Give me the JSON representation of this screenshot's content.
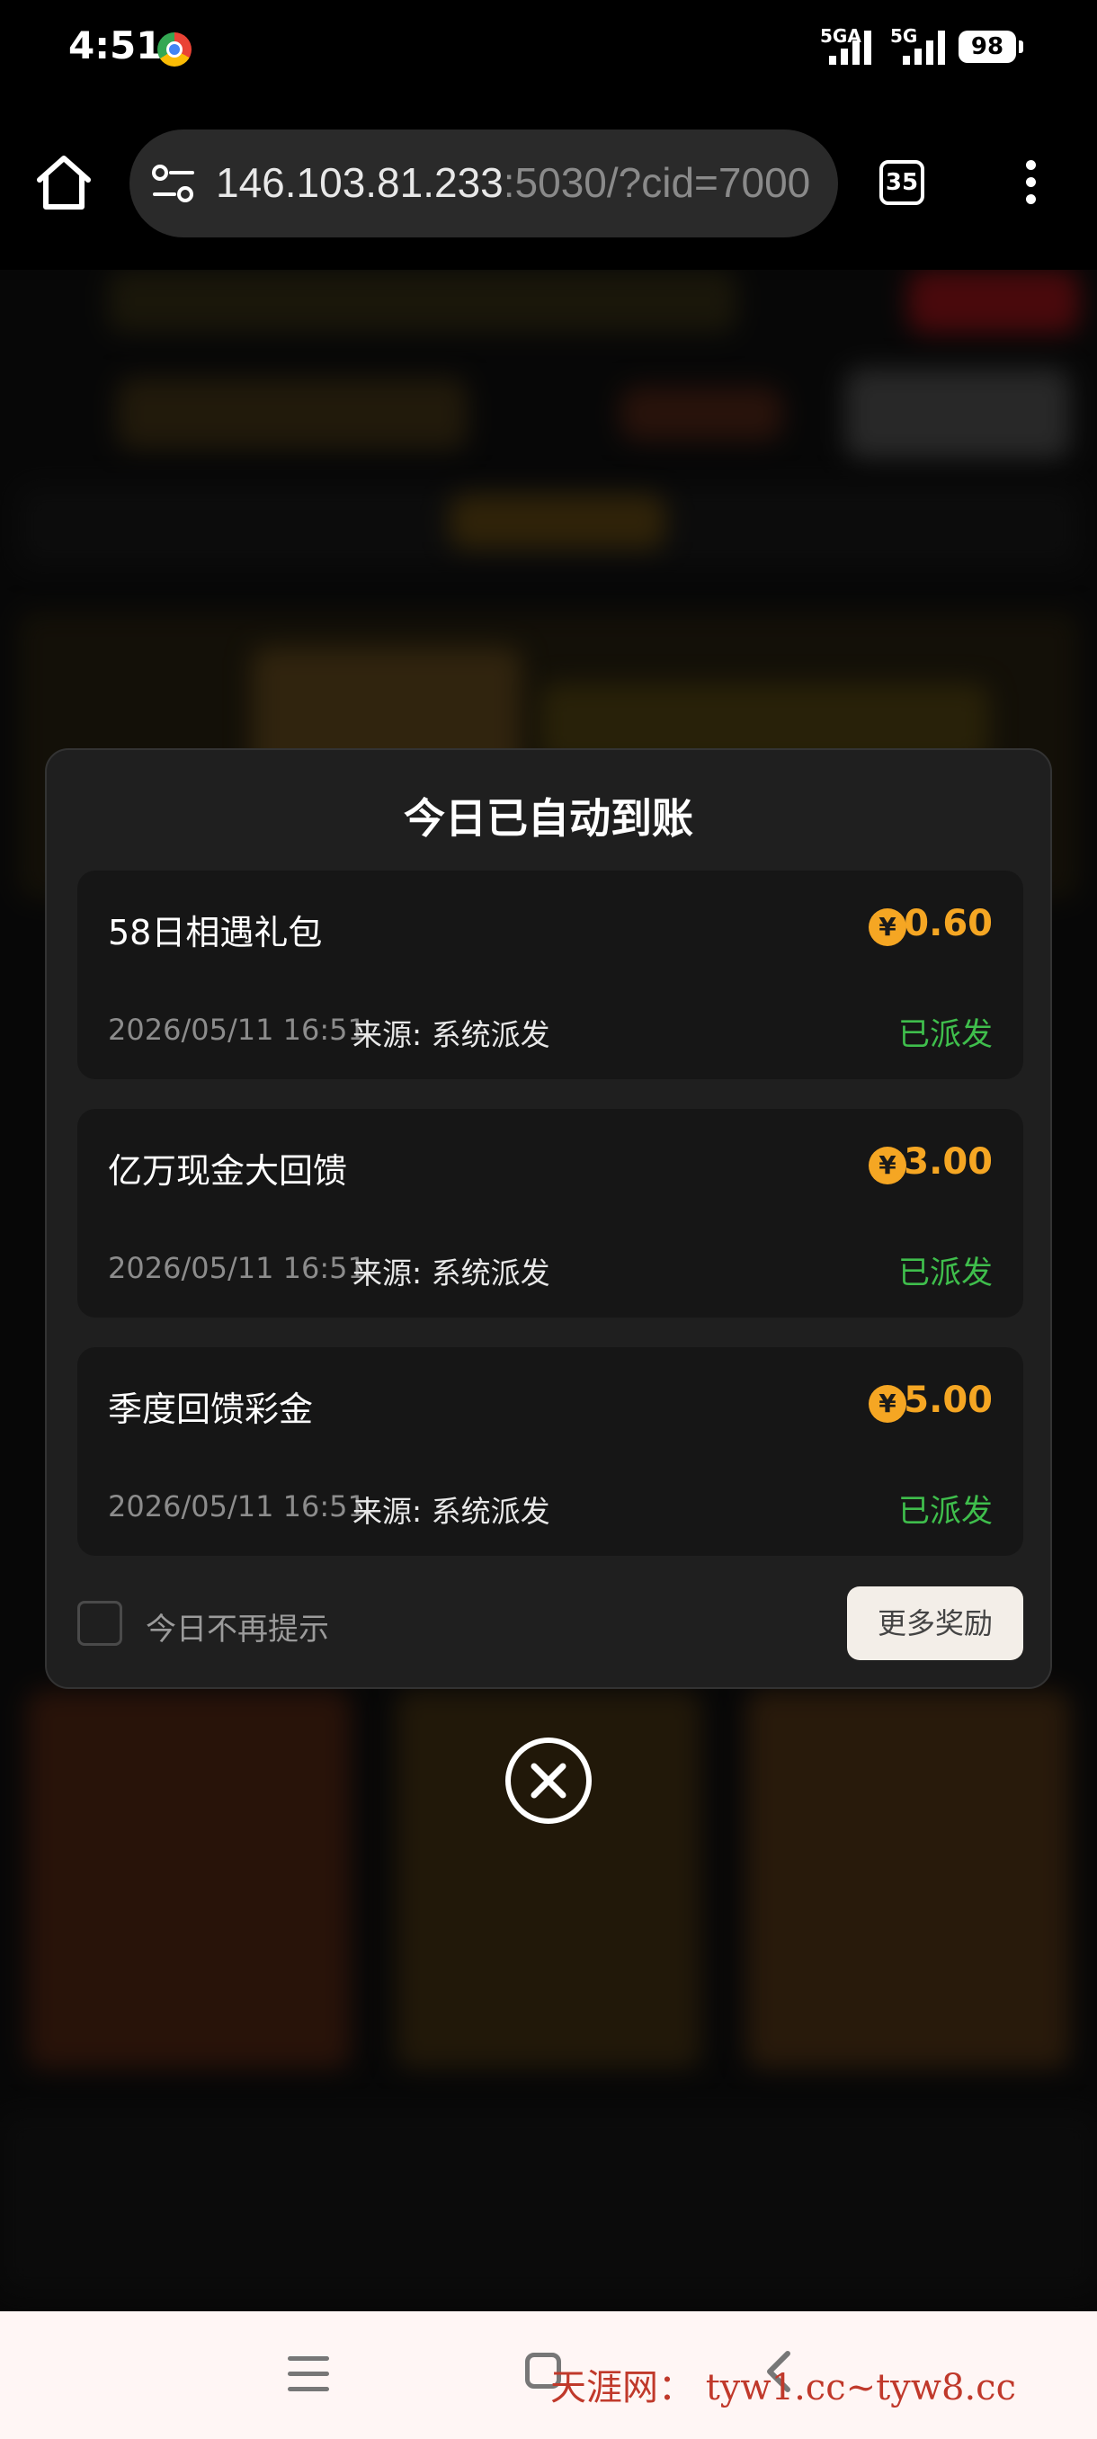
{
  "status_bar": {
    "time": "4:51",
    "signal1": "5GA",
    "signal2": "5G",
    "battery": "98"
  },
  "browser": {
    "url_host": "146.103.81.233",
    "url_rest": ":5030/?cid=7000",
    "tab_count": "35"
  },
  "modal": {
    "title": "今日已自动到账",
    "items": [
      {
        "title": "58日相遇礼包",
        "amount": "0.60",
        "date": "2026/05/11 16:51",
        "source": "来源: 系统派发",
        "status": "已派发"
      },
      {
        "title": "亿万现金大回馈",
        "amount": "3.00",
        "date": "2026/05/11 16:51",
        "source": "来源: 系统派发",
        "status": "已派发"
      },
      {
        "title": "季度回馈彩金",
        "amount": "5.00",
        "date": "2026/05/11 16:51",
        "source": "来源: 系统派发",
        "status": "已派发"
      }
    ],
    "currency_symbol": "¥",
    "dont_show_label": "今日不再提示",
    "more_button": "更多奖励"
  },
  "watermark": "天涯网： tyw1.cc~tyw8.cc",
  "colors": {
    "amount": "#f5a623",
    "status": "#3fbe4c",
    "modal_bg": "#1f1f1f"
  }
}
